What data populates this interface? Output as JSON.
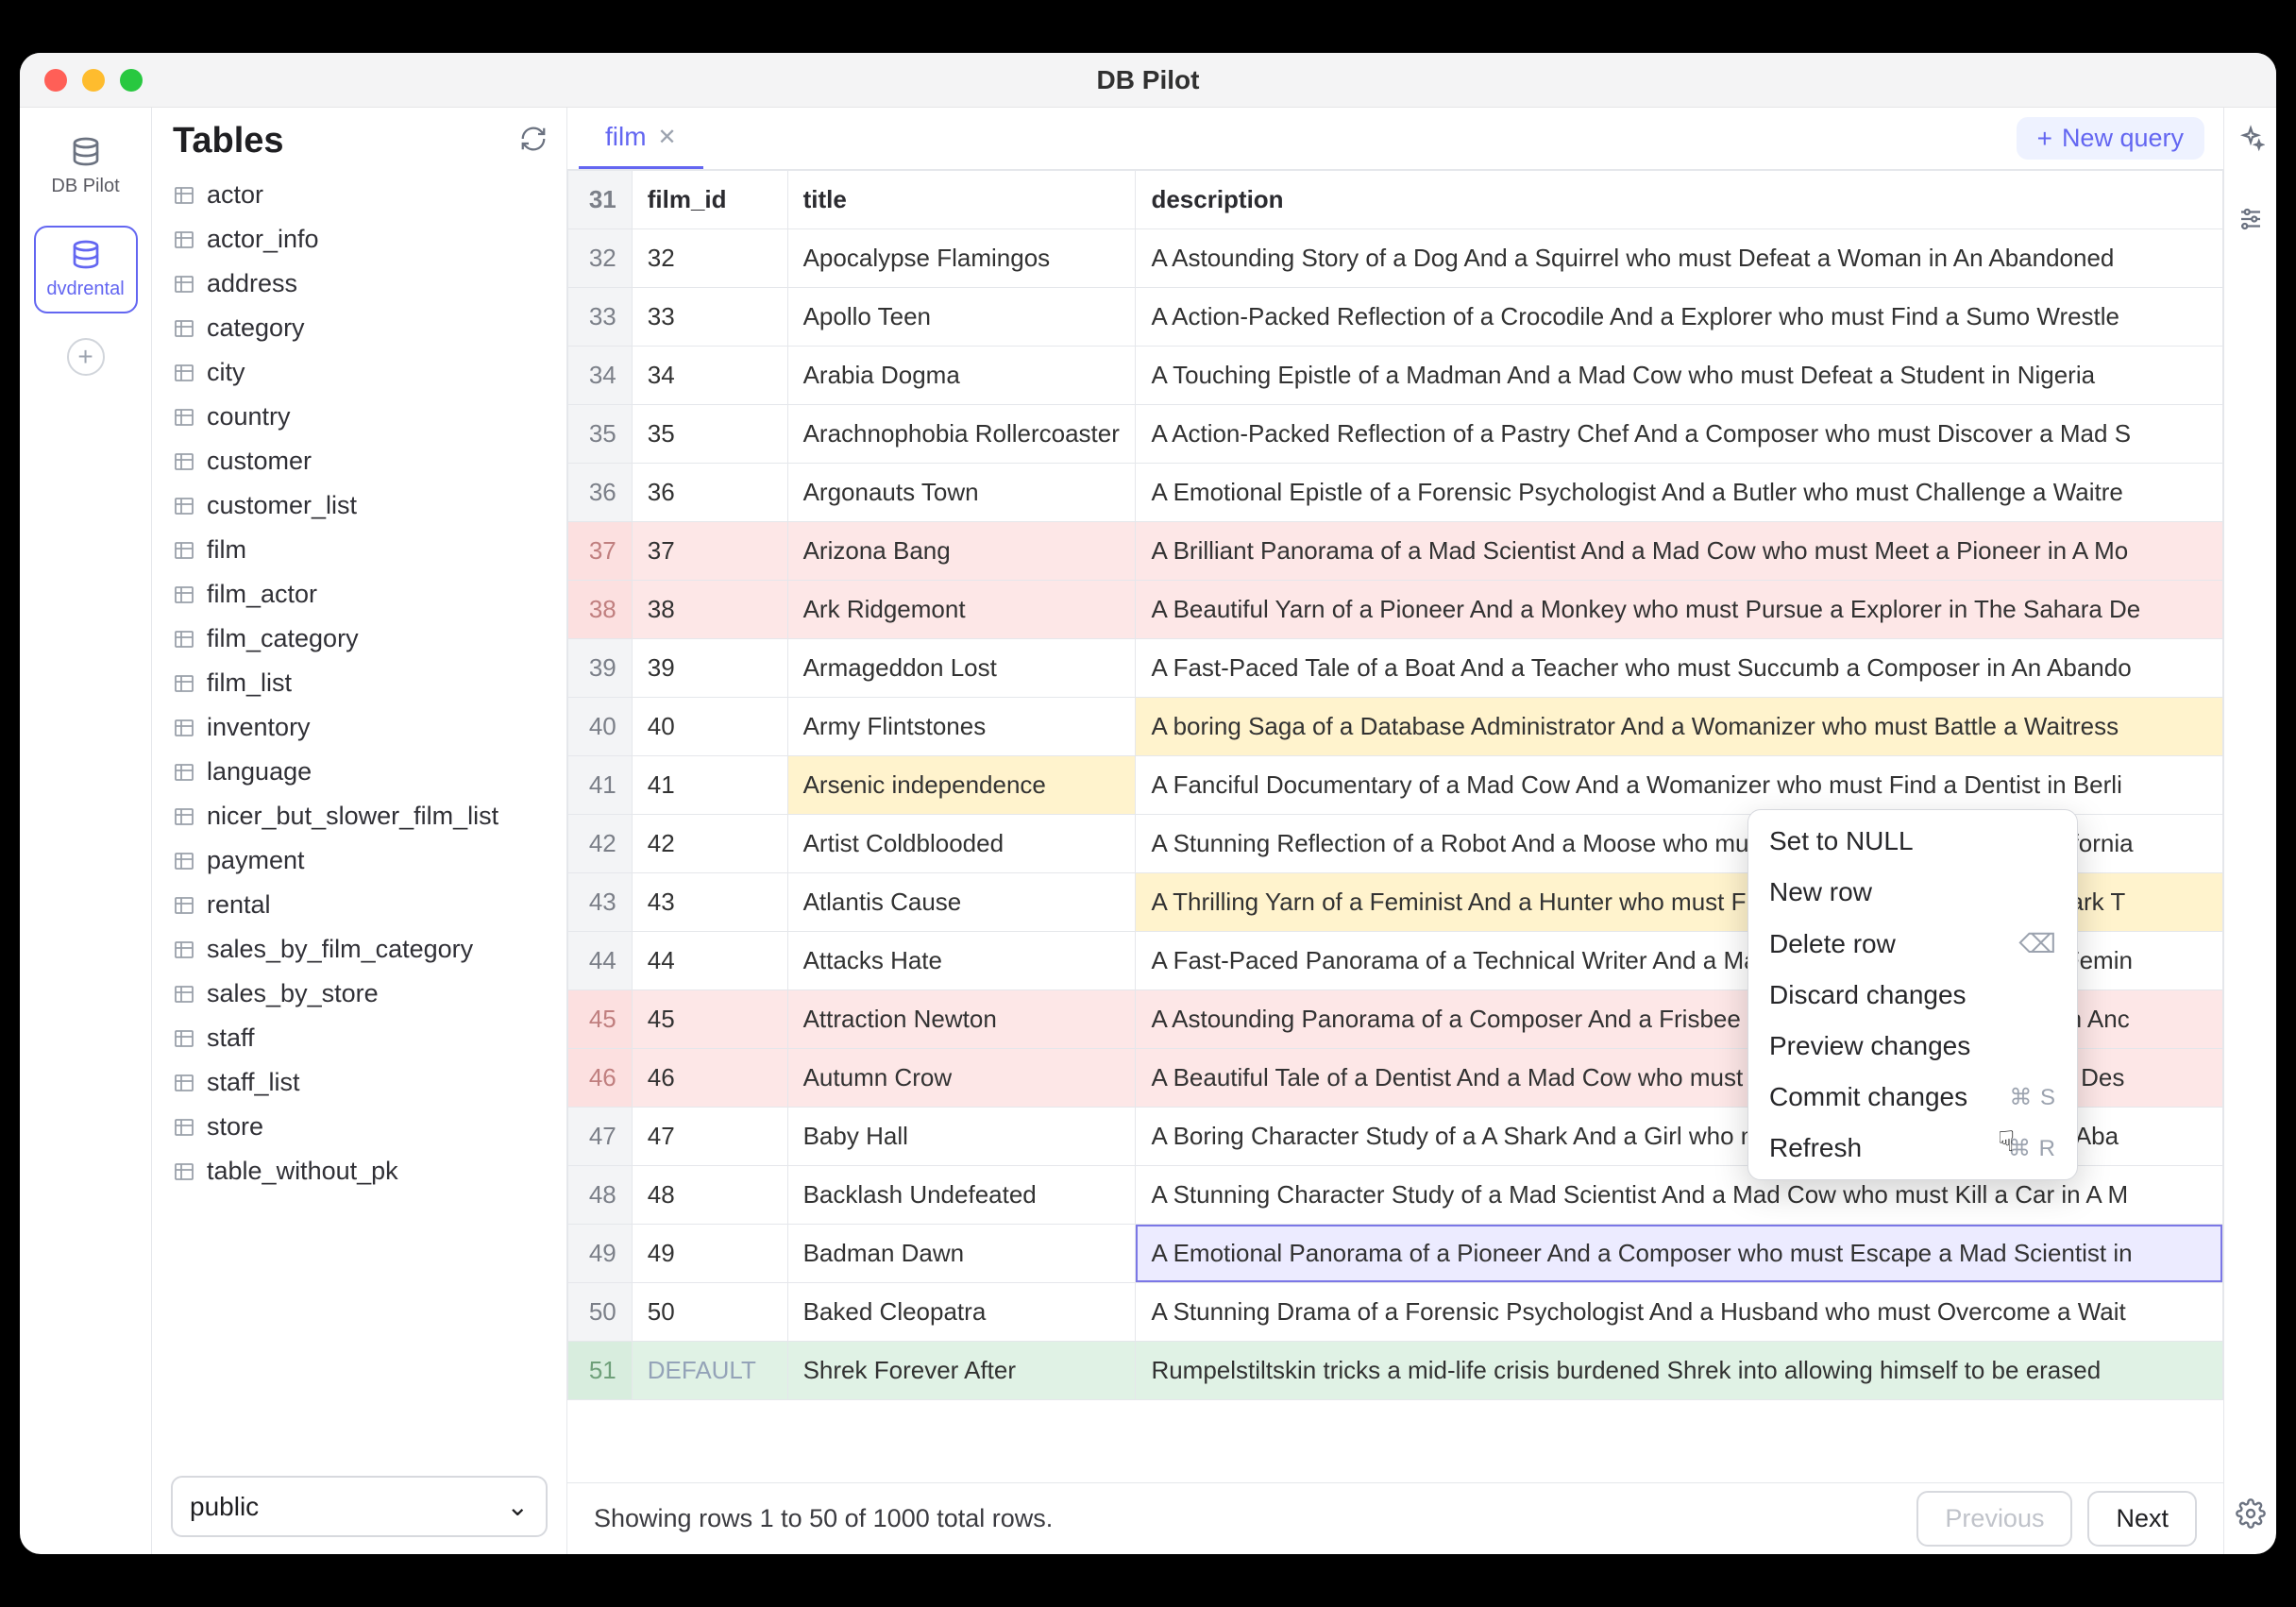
{
  "app_title": "DB Pilot",
  "rail": {
    "app": "DB Pilot",
    "db": "dvdrental"
  },
  "sidebar": {
    "title": "Tables",
    "items": [
      "actor",
      "actor_info",
      "address",
      "category",
      "city",
      "country",
      "customer",
      "customer_list",
      "film",
      "film_actor",
      "film_category",
      "film_list",
      "inventory",
      "language",
      "nicer_but_slower_film_list",
      "payment",
      "rental",
      "sales_by_film_category",
      "sales_by_store",
      "staff",
      "staff_list",
      "store",
      "table_without_pk"
    ],
    "schema": "public"
  },
  "tab": {
    "label": "film"
  },
  "new_query_label": "New query",
  "columns": {
    "film_id": "film_id",
    "title": "title",
    "description": "description"
  },
  "rows": [
    {
      "n": 31,
      "id": "",
      "title": "",
      "desc": "",
      "state": ""
    },
    {
      "n": 32,
      "id": "32",
      "title": "Apocalypse Flamingos",
      "desc": "A Astounding Story of a Dog And a Squirrel who must Defeat a Woman in An Abandoned",
      "state": ""
    },
    {
      "n": 33,
      "id": "33",
      "title": "Apollo Teen",
      "desc": "A Action-Packed Reflection of a Crocodile And a Explorer who must Find a Sumo Wrestle",
      "state": ""
    },
    {
      "n": 34,
      "id": "34",
      "title": "Arabia Dogma",
      "desc": "A Touching Epistle of a Madman And a Mad Cow who must Defeat a Student in Nigeria",
      "state": ""
    },
    {
      "n": 35,
      "id": "35",
      "title": "Arachnophobia Rollercoaster",
      "desc": "A Action-Packed Reflection of a Pastry Chef And a Composer who must Discover a Mad S",
      "state": ""
    },
    {
      "n": 36,
      "id": "36",
      "title": "Argonauts Town",
      "desc": "A Emotional Epistle of a Forensic Psychologist And a Butler who must Challenge a Waitre",
      "state": ""
    },
    {
      "n": 37,
      "id": "37",
      "title": "Arizona Bang",
      "desc": "A Brilliant Panorama of a Mad Scientist And a Mad Cow who must Meet a Pioneer in A Mo",
      "state": "deleted"
    },
    {
      "n": 38,
      "id": "38",
      "title": "Ark Ridgemont",
      "desc": "A Beautiful Yarn of a Pioneer And a Monkey who must Pursue a Explorer in The Sahara De",
      "state": "deleted"
    },
    {
      "n": 39,
      "id": "39",
      "title": "Armageddon Lost",
      "desc": "A Fast-Paced Tale of a Boat And a Teacher who must Succumb a Composer in An Abando",
      "state": ""
    },
    {
      "n": 40,
      "id": "40",
      "title": "Army Flintstones",
      "desc": "A boring Saga of a Database Administrator And a Womanizer who must Battle a Waitress",
      "state": "",
      "desc_edited": true
    },
    {
      "n": 41,
      "id": "41",
      "title": "Arsenic independence",
      "desc": "A Fanciful Documentary of a Mad Cow And a Womanizer who must Find a Dentist in Berli",
      "state": "",
      "title_edited": true
    },
    {
      "n": 42,
      "id": "42",
      "title": "Artist Coldblooded",
      "desc": "A Stunning Reflection of a Robot And a Moose who must Challenge a Woman in California",
      "state": ""
    },
    {
      "n": 43,
      "id": "43",
      "title": "Atlantis Cause",
      "desc": "A Thrilling Yarn of a Feminist And a Hunter who must Fight a Technical Writer in A Shark T",
      "state": "",
      "desc_edited": true
    },
    {
      "n": 44,
      "id": "44",
      "title": "Attacks Hate",
      "desc": "A Fast-Paced Panorama of a Technical Writer And a Mad Scientist who must Find a Femin",
      "state": ""
    },
    {
      "n": 45,
      "id": "45",
      "title": "Attraction Newton",
      "desc": "A Astounding Panorama of a Composer And a Frisbee who must Reach a Husband in Anc",
      "state": "deleted"
    },
    {
      "n": 46,
      "id": "46",
      "title": "Autumn Crow",
      "desc": "A Beautiful Tale of a Dentist And a Mad Cow who must Battle a Moose in The Sahara Des",
      "state": "deleted"
    },
    {
      "n": 47,
      "id": "47",
      "title": "Baby Hall",
      "desc": "A Boring Character Study of a A Shark And a Girl who must Outrace a Feminist in An Aba",
      "state": ""
    },
    {
      "n": 48,
      "id": "48",
      "title": "Backlash Undefeated",
      "desc": "A Stunning Character Study of a Mad Scientist And a Mad Cow who must Kill a Car in A M",
      "state": ""
    },
    {
      "n": 49,
      "id": "49",
      "title": "Badman Dawn",
      "desc": "A Emotional Panorama of a Pioneer And a Composer who must Escape a Mad Scientist in",
      "state": "selected"
    },
    {
      "n": 50,
      "id": "50",
      "title": "Baked Cleopatra",
      "desc": "A Stunning Drama of a Forensic Psychologist And a Husband who must Overcome a Wait",
      "state": ""
    },
    {
      "n": 51,
      "id": "DEFAULT",
      "title": "Shrek Forever After",
      "desc": "Rumpelstiltskin tricks a mid-life crisis burdened Shrek into allowing himself to be erased",
      "state": "inserted",
      "id_default": true
    }
  ],
  "footer": {
    "text": "Showing rows 1 to 50 of 1000 total rows.",
    "prev": "Previous",
    "next": "Next"
  },
  "ctx": {
    "set_null": "Set to NULL",
    "new_row": "New row",
    "delete_row": "Delete row",
    "discard": "Discard changes",
    "preview": "Preview changes",
    "commit": "Commit changes",
    "commit_kb": "⌘ S",
    "refresh": "Refresh",
    "refresh_kb": "⌘ R"
  }
}
